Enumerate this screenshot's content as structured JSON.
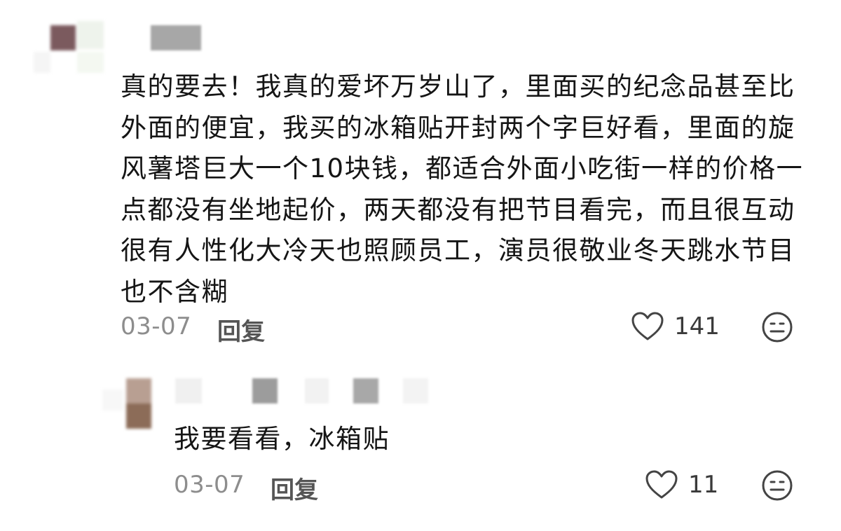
{
  "comment": {
    "text": "真的要去！我真的爱坏万岁山了，里面买的纪念品甚至比外面的便宜，我买的冰箱贴开封两个字巨好看，里面的旋风薯塔巨大一个10块钱，都适合外面小吃街一样的价格一点都没有坐地起价，两天都没有把节目看完，而且很互动很有人性化大冷天也照顾员工，演员很敬业冬天跳水节目也不含糊",
    "date": "03-07",
    "reply_label": "回复",
    "like_count": "141",
    "like_icon": "heart-outline-icon",
    "emoji_icon": "emoji-face-icon"
  },
  "reply": {
    "text": "我要看看，冰箱贴",
    "date": "03-07",
    "reply_label": "回复",
    "like_count": "11",
    "like_icon": "heart-outline-icon",
    "emoji_icon": "emoji-face-icon"
  },
  "colors": {
    "text": "#151515",
    "meta": "#8d8d8d",
    "icon": "#444444",
    "background": "#ffffff"
  }
}
